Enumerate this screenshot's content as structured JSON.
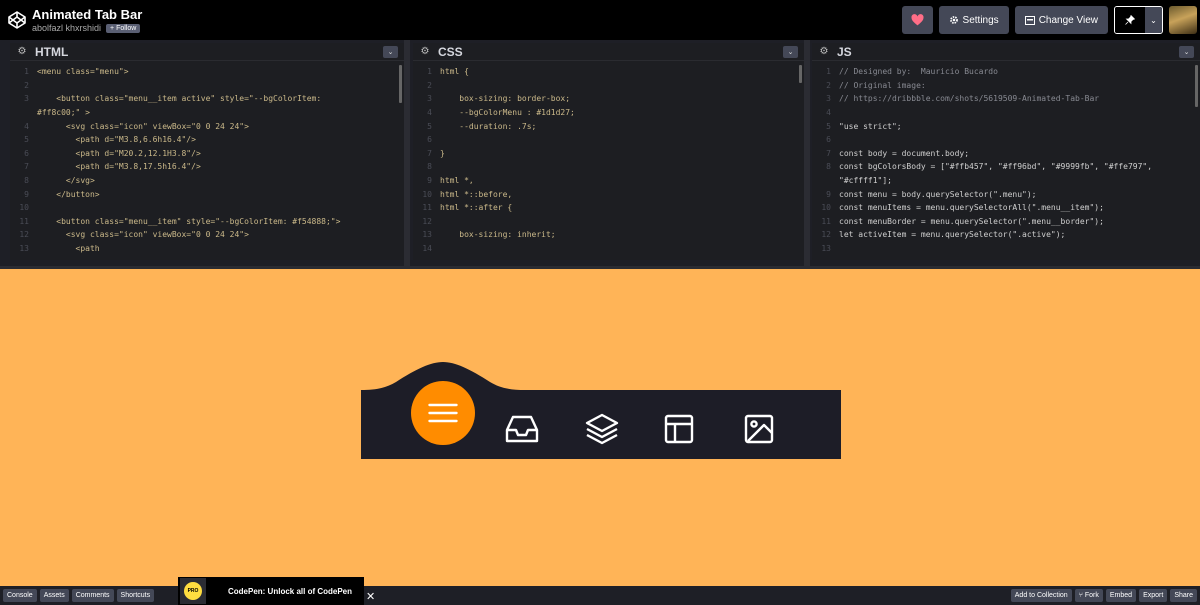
{
  "header": {
    "title": "Animated Tab Bar",
    "author": "abolfazl khxrshidi",
    "follow_label": "+ Follow",
    "settings_label": "Settings",
    "change_view_label": "Change View",
    "heart_color": "#ff6e87"
  },
  "editors": [
    {
      "lang": "HTML",
      "lines": [
        {
          "n": "1",
          "t": "<menu class=\"menu\">"
        },
        {
          "n": "2",
          "t": ""
        },
        {
          "n": "3",
          "t": "    <button class=\"menu__item active\" style=\"--bgColorItem:"
        },
        {
          "n": "",
          "t": "#ff8c00;\" >"
        },
        {
          "n": "4",
          "t": "      <svg class=\"icon\" viewBox=\"0 0 24 24\">"
        },
        {
          "n": "5",
          "t": "        <path d=\"M3.8,6.6h16.4\"/>"
        },
        {
          "n": "6",
          "t": "        <path d=\"M20.2,12.1H3.8\"/>"
        },
        {
          "n": "7",
          "t": "        <path d=\"M3.8,17.5h16.4\"/>"
        },
        {
          "n": "8",
          "t": "      </svg>"
        },
        {
          "n": "9",
          "t": "    </button>"
        },
        {
          "n": "10",
          "t": ""
        },
        {
          "n": "11",
          "t": "    <button class=\"menu__item\" style=\"--bgColorItem: #f54888;\">"
        },
        {
          "n": "12",
          "t": "      <svg class=\"icon\" viewBox=\"0 0 24 24\">"
        },
        {
          "n": "13",
          "t": "        <path"
        }
      ]
    },
    {
      "lang": "CSS",
      "lines": [
        {
          "n": "1",
          "t": "html {"
        },
        {
          "n": "2",
          "t": ""
        },
        {
          "n": "3",
          "t": "    box-sizing: border-box;"
        },
        {
          "n": "4",
          "t": "    --bgColorMenu : #1d1d27;"
        },
        {
          "n": "5",
          "t": "    --duration: .7s;"
        },
        {
          "n": "6",
          "t": ""
        },
        {
          "n": "7",
          "t": "}"
        },
        {
          "n": "8",
          "t": ""
        },
        {
          "n": "9",
          "t": "html *,"
        },
        {
          "n": "10",
          "t": "html *::before,"
        },
        {
          "n": "11",
          "t": "html *::after {"
        },
        {
          "n": "12",
          "t": ""
        },
        {
          "n": "13",
          "t": "    box-sizing: inherit;"
        },
        {
          "n": "14",
          "t": ""
        }
      ]
    },
    {
      "lang": "JS",
      "lines": [
        {
          "n": "1",
          "t": "// Designed by:  Mauricio Bucardo",
          "c": true
        },
        {
          "n": "2",
          "t": "// Original image:",
          "c": true
        },
        {
          "n": "3",
          "t": "// https://dribbble.com/shots/5619509-Animated-Tab-Bar",
          "c": true
        },
        {
          "n": "4",
          "t": ""
        },
        {
          "n": "5",
          "t": "\"use strict\";"
        },
        {
          "n": "6",
          "t": ""
        },
        {
          "n": "7",
          "t": "const body = document.body;"
        },
        {
          "n": "8",
          "t": "const bgColorsBody = [\"#ffb457\", \"#ff96bd\", \"#9999fb\", \"#ffe797\","
        },
        {
          "n": "",
          "t": "\"#cffff1\"];"
        },
        {
          "n": "9",
          "t": "const menu = body.querySelector(\".menu\");"
        },
        {
          "n": "10",
          "t": "const menuItems = menu.querySelectorAll(\".menu__item\");"
        },
        {
          "n": "11",
          "t": "const menuBorder = menu.querySelector(\".menu__border\");"
        },
        {
          "n": "12",
          "t": "let activeItem = menu.querySelector(\".active\");"
        },
        {
          "n": "13",
          "t": ""
        }
      ]
    }
  ],
  "preview": {
    "bg_color": "#ffb457",
    "menu_color": "#1d1d27",
    "active_color": "#ff8c00",
    "items": [
      "menu-icon",
      "inbox-icon",
      "layers-icon",
      "layout-icon",
      "image-icon"
    ]
  },
  "bottom": {
    "left_buttons": [
      "Console",
      "Assets",
      "Comments",
      "Shortcuts"
    ],
    "promo_text": "CodePen: Unlock all of CodePen",
    "pro_label": "PRO",
    "right_buttons": [
      "Add to Collection",
      "Fork",
      "Embed",
      "Export",
      "Share"
    ]
  }
}
